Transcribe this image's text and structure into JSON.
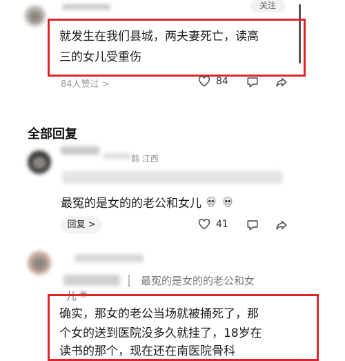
{
  "top_comment": {
    "follow_label": "关注",
    "text_line1": "就发生在我们县城，两夫妻死亡，读高",
    "text_line2": "三的女儿受重伤",
    "likes_label": "84人赞过 >",
    "like_count": "84"
  },
  "replies_header": "全部回复",
  "reply1": {
    "time_location": "前  江西",
    "text": "最冤的是女的的老公和女儿",
    "reply_button_label": "回复 >",
    "like_count": "41"
  },
  "reply2": {
    "quote_text_line1": "最冤的是女的的老公和女",
    "quote_text_line2": "儿",
    "text_line1": "确实，那女的老公当场就被捅死了，那",
    "text_line2": "个女的送到医院没多久就挂了，18岁在",
    "text_line3": "读书的那个，现在还在南医院骨科"
  },
  "icons": [
    "heart-icon",
    "comment-icon",
    "share-icon",
    "skull-emoji"
  ],
  "colors": {
    "highlight_border": "#e0232b",
    "meta_text": "#888888"
  }
}
